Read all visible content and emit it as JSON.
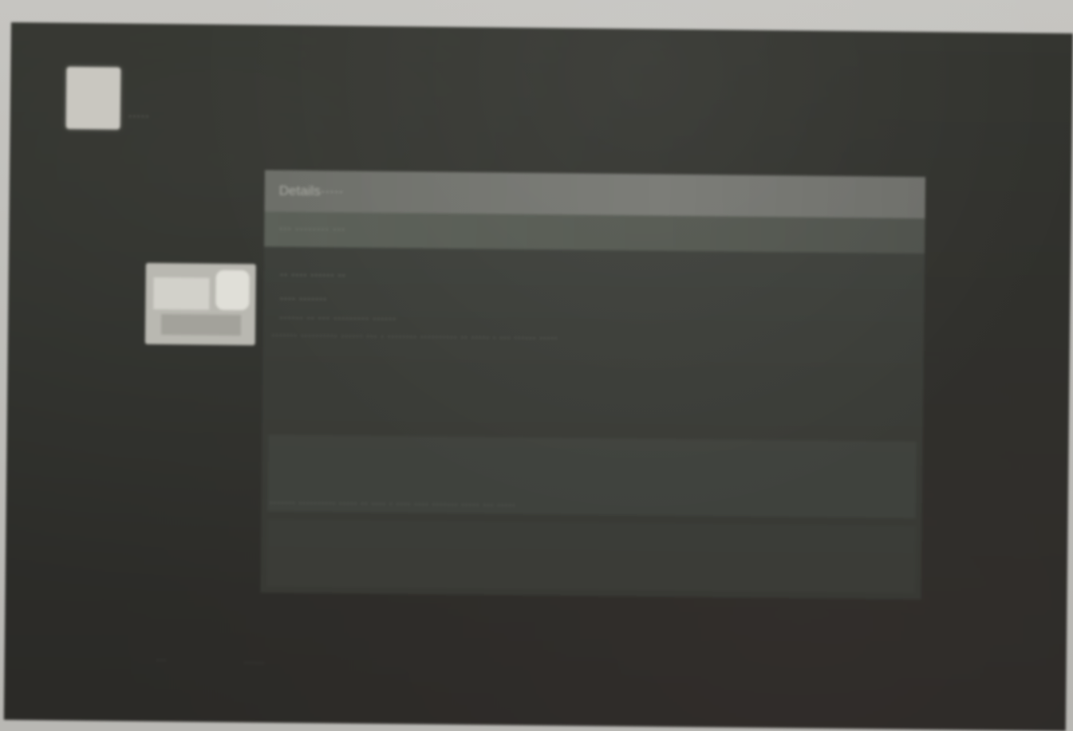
{
  "app": {
    "logo_text": "·····"
  },
  "post": {
    "title": "Details·····",
    "subtitle": "··· ········ ···",
    "meta": [
      "·· ···· ······ ··",
      "···· ·······",
      "······ ·· ··· ········· ······"
    ],
    "body_lines": [
      "······· ·········· ······ ··· · ········ ·········· ·· ····· · ··· ······ ·····",
      "",
      "······· ·········· ····· ·· ···· · ···· ···· ······· ····· ··· ·····"
    ]
  },
  "footer": {
    "left": "···",
    "mid": "······"
  }
}
